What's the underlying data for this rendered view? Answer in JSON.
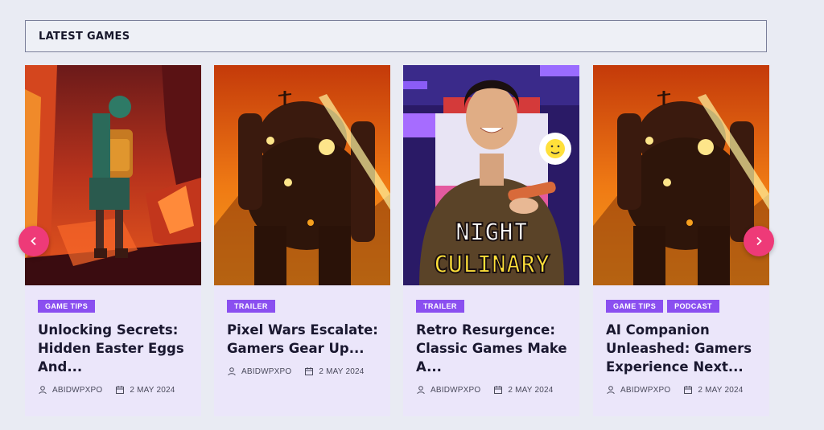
{
  "section": {
    "title": "LATEST GAMES"
  },
  "cards": [
    {
      "tags": [
        "GAME TIPS"
      ],
      "title": "Unlocking Secrets: Hidden Easter Eggs And...",
      "author": "ABIDWPXPO",
      "date": "2 MAY 2024",
      "image_icon": "adventurer-cave-illustration"
    },
    {
      "tags": [
        "TRAILER"
      ],
      "title": "Pixel Wars Escalate: Gamers Gear Up...",
      "author": "ABIDWPXPO",
      "date": "2 MAY 2024",
      "image_icon": "giant-robot-illustration"
    },
    {
      "tags": [
        "TRAILER"
      ],
      "title": "Retro Resurgence: Classic Games Make A...",
      "author": "ABIDWPXPO",
      "date": "2 MAY 2024",
      "image_icon": "night-culinary-photo",
      "image_text_line1": "NIGHT",
      "image_text_line2": "CULINARY"
    },
    {
      "tags": [
        "GAME TIPS",
        "PODCAST"
      ],
      "title": "AI Companion Unleashed: Gamers Experience Next...",
      "author": "ABIDWPXPO",
      "date": "2 MAY 2024",
      "image_icon": "giant-robot-illustration"
    }
  ],
  "nav": {
    "prev_icon": "chevron-left-icon",
    "next_icon": "chevron-right-icon"
  },
  "colors": {
    "accent": "#8a4ff0",
    "nav": "#ee3a78",
    "card_bg": "#ebe6fa",
    "page_bg": "#e9ebf3"
  }
}
